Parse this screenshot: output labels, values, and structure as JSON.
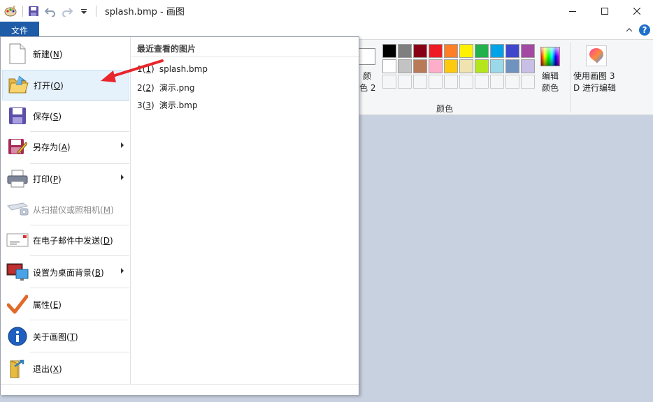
{
  "window": {
    "title": "splash.bmp - 画图"
  },
  "ribbon": {
    "file_tab": "文件",
    "color2_label": "颜\n色 2",
    "edit_colors_label": "编辑\n颜色",
    "paint3d_label": "使用画图 3\nD 进行编辑",
    "colors_group_label": "颜色",
    "palette_row1": [
      "#000000",
      "#7f7f7f",
      "#880015",
      "#ed1c24",
      "#ff7f27",
      "#fff200",
      "#22b14c",
      "#00a2e8",
      "#3f48cc",
      "#a349a4"
    ],
    "palette_row2": [
      "#ffffff",
      "#c3c3c3",
      "#b97a57",
      "#ffaec9",
      "#ffc90e",
      "#efe4b0",
      "#b5e61d",
      "#99d9ea",
      "#7092be",
      "#c8bfe7"
    ]
  },
  "menu": {
    "items": [
      {
        "label": "新建",
        "key": "N"
      },
      {
        "label": "打开",
        "key": "O"
      },
      {
        "label": "保存",
        "key": "S"
      },
      {
        "label": "另存为",
        "key": "A"
      },
      {
        "label": "打印",
        "key": "P"
      },
      {
        "label": "从扫描仪或照相机",
        "key": "M"
      },
      {
        "label": "在电子邮件中发送",
        "key": "D"
      },
      {
        "label": "设置为桌面背景",
        "key": "B"
      },
      {
        "label": "属性",
        "key": "E"
      },
      {
        "label": "关于画图",
        "key": "T"
      },
      {
        "label": "退出",
        "key": "X"
      }
    ],
    "recent_title": "最近查看的图片",
    "recent": [
      {
        "num": "1",
        "name": "splash.bmp"
      },
      {
        "num": "2",
        "name": "演示.png"
      },
      {
        "num": "3",
        "name": "演示.bmp"
      }
    ]
  }
}
